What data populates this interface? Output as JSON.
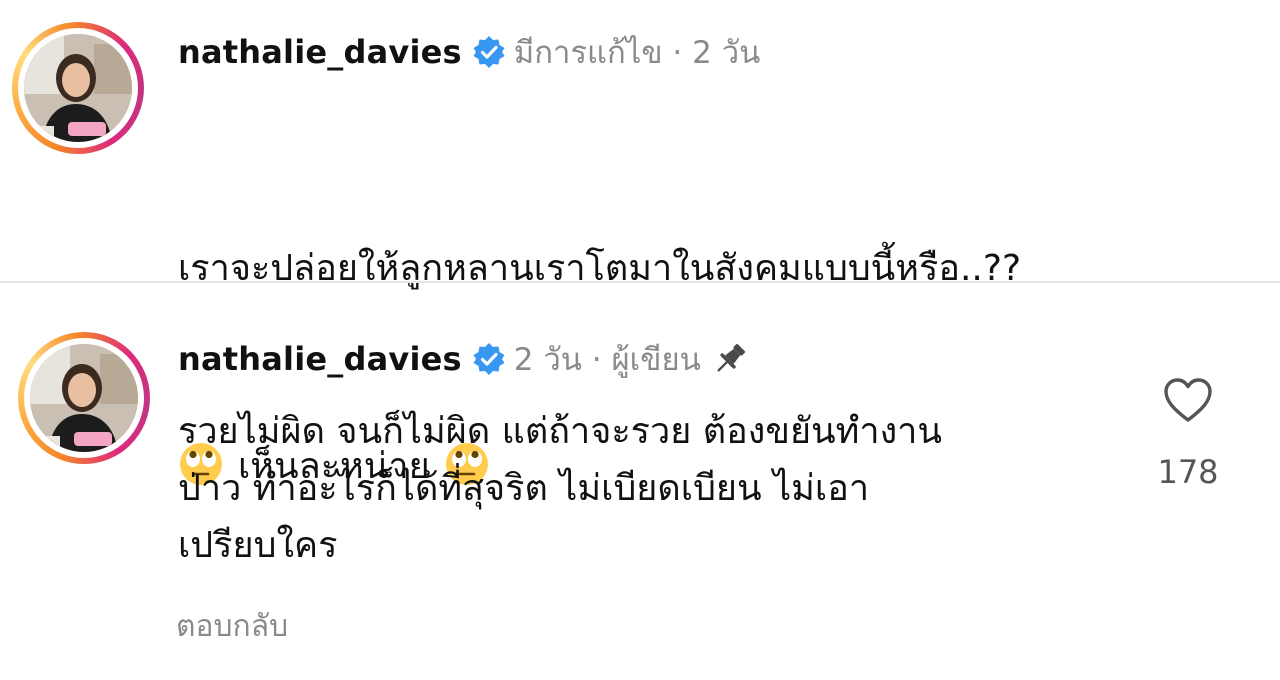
{
  "comments": [
    {
      "username": "nathalie_davies",
      "verified": true,
      "meta": "มีการแก้ไข · 2 วัน",
      "line1": "เราจะปล่อยให้ลูกหลานเราโตมาในสังคมแบบนี้หรือ..??",
      "emoji_text": "เห็นละหน่าย",
      "emoji_name": "face-with-rolling-eyes-icon"
    },
    {
      "username": "nathalie_davies",
      "verified": true,
      "meta": "2 วัน · ผู้เขียน",
      "pinned_icon": "pin-icon",
      "text": "รวยไม่ผิด จนก็ไม่ผิด แต่ถ้าจะรวย ต้องขยันทำงาน\nป่าว ทำอะไรก็ได้ที่สุจริต ไม่เบียดเบียน ไม่เอา\nเปรียบใคร",
      "reply_label": "ตอบกลับ",
      "like_icon": "heart-outline-icon",
      "like_count": "178"
    }
  ],
  "colors": {
    "verified_blue": "#3897f0",
    "meta_gray": "#8a8a8a",
    "divider": "#e6e6e6"
  }
}
